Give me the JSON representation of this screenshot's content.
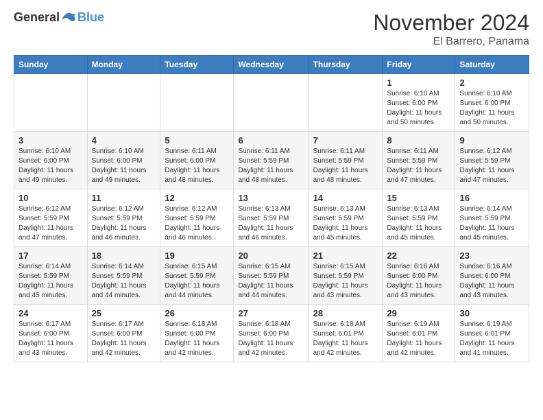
{
  "header": {
    "logo": {
      "general": "General",
      "blue": "Blue"
    },
    "title": "November 2024",
    "location": "El Barrero, Panama"
  },
  "weekdays": [
    "Sunday",
    "Monday",
    "Tuesday",
    "Wednesday",
    "Thursday",
    "Friday",
    "Saturday"
  ],
  "weeks": [
    [
      {
        "day": "",
        "info": ""
      },
      {
        "day": "",
        "info": ""
      },
      {
        "day": "",
        "info": ""
      },
      {
        "day": "",
        "info": ""
      },
      {
        "day": "",
        "info": ""
      },
      {
        "day": "1",
        "info": "Sunrise: 6:10 AM\nSunset: 6:00 PM\nDaylight: 11 hours\nand 50 minutes."
      },
      {
        "day": "2",
        "info": "Sunrise: 6:10 AM\nSunset: 6:00 PM\nDaylight: 11 hours\nand 50 minutes."
      }
    ],
    [
      {
        "day": "3",
        "info": "Sunrise: 6:10 AM\nSunset: 6:00 PM\nDaylight: 11 hours\nand 49 minutes."
      },
      {
        "day": "4",
        "info": "Sunrise: 6:10 AM\nSunset: 6:00 PM\nDaylight: 11 hours\nand 49 minutes."
      },
      {
        "day": "5",
        "info": "Sunrise: 6:11 AM\nSunset: 6:00 PM\nDaylight: 11 hours\nand 48 minutes."
      },
      {
        "day": "6",
        "info": "Sunrise: 6:11 AM\nSunset: 5:59 PM\nDaylight: 11 hours\nand 48 minutes."
      },
      {
        "day": "7",
        "info": "Sunrise: 6:11 AM\nSunset: 5:59 PM\nDaylight: 11 hours\nand 48 minutes."
      },
      {
        "day": "8",
        "info": "Sunrise: 6:11 AM\nSunset: 5:59 PM\nDaylight: 11 hours\nand 47 minutes."
      },
      {
        "day": "9",
        "info": "Sunrise: 6:12 AM\nSunset: 5:59 PM\nDaylight: 11 hours\nand 47 minutes."
      }
    ],
    [
      {
        "day": "10",
        "info": "Sunrise: 6:12 AM\nSunset: 5:59 PM\nDaylight: 11 hours\nand 47 minutes."
      },
      {
        "day": "11",
        "info": "Sunrise: 6:12 AM\nSunset: 5:59 PM\nDaylight: 11 hours\nand 46 minutes."
      },
      {
        "day": "12",
        "info": "Sunrise: 6:12 AM\nSunset: 5:59 PM\nDaylight: 11 hours\nand 46 minutes."
      },
      {
        "day": "13",
        "info": "Sunrise: 6:13 AM\nSunset: 5:59 PM\nDaylight: 11 hours\nand 46 minutes."
      },
      {
        "day": "14",
        "info": "Sunrise: 6:13 AM\nSunset: 5:59 PM\nDaylight: 11 hours\nand 45 minutes."
      },
      {
        "day": "15",
        "info": "Sunrise: 6:13 AM\nSunset: 5:59 PM\nDaylight: 11 hours\nand 45 minutes."
      },
      {
        "day": "16",
        "info": "Sunrise: 6:14 AM\nSunset: 5:59 PM\nDaylight: 11 hours\nand 45 minutes."
      }
    ],
    [
      {
        "day": "17",
        "info": "Sunrise: 6:14 AM\nSunset: 5:59 PM\nDaylight: 11 hours\nand 45 minutes."
      },
      {
        "day": "18",
        "info": "Sunrise: 6:14 AM\nSunset: 5:59 PM\nDaylight: 11 hours\nand 44 minutes."
      },
      {
        "day": "19",
        "info": "Sunrise: 6:15 AM\nSunset: 5:59 PM\nDaylight: 11 hours\nand 44 minutes."
      },
      {
        "day": "20",
        "info": "Sunrise: 6:15 AM\nSunset: 5:59 PM\nDaylight: 11 hours\nand 44 minutes."
      },
      {
        "day": "21",
        "info": "Sunrise: 6:15 AM\nSunset: 5:59 PM\nDaylight: 11 hours\nand 43 minutes."
      },
      {
        "day": "22",
        "info": "Sunrise: 6:16 AM\nSunset: 6:00 PM\nDaylight: 11 hours\nand 43 minutes."
      },
      {
        "day": "23",
        "info": "Sunrise: 6:16 AM\nSunset: 6:00 PM\nDaylight: 11 hours\nand 43 minutes."
      }
    ],
    [
      {
        "day": "24",
        "info": "Sunrise: 6:17 AM\nSunset: 6:00 PM\nDaylight: 11 hours\nand 43 minutes."
      },
      {
        "day": "25",
        "info": "Sunrise: 6:17 AM\nSunset: 6:00 PM\nDaylight: 11 hours\nand 42 minutes."
      },
      {
        "day": "26",
        "info": "Sunrise: 6:18 AM\nSunset: 6:00 PM\nDaylight: 11 hours\nand 42 minutes."
      },
      {
        "day": "27",
        "info": "Sunrise: 6:18 AM\nSunset: 6:00 PM\nDaylight: 11 hours\nand 42 minutes."
      },
      {
        "day": "28",
        "info": "Sunrise: 6:18 AM\nSunset: 6:01 PM\nDaylight: 11 hours\nand 42 minutes."
      },
      {
        "day": "29",
        "info": "Sunrise: 6:19 AM\nSunset: 6:01 PM\nDaylight: 11 hours\nand 42 minutes."
      },
      {
        "day": "30",
        "info": "Sunrise: 6:19 AM\nSunset: 6:01 PM\nDaylight: 11 hours\nand 41 minutes."
      }
    ]
  ]
}
